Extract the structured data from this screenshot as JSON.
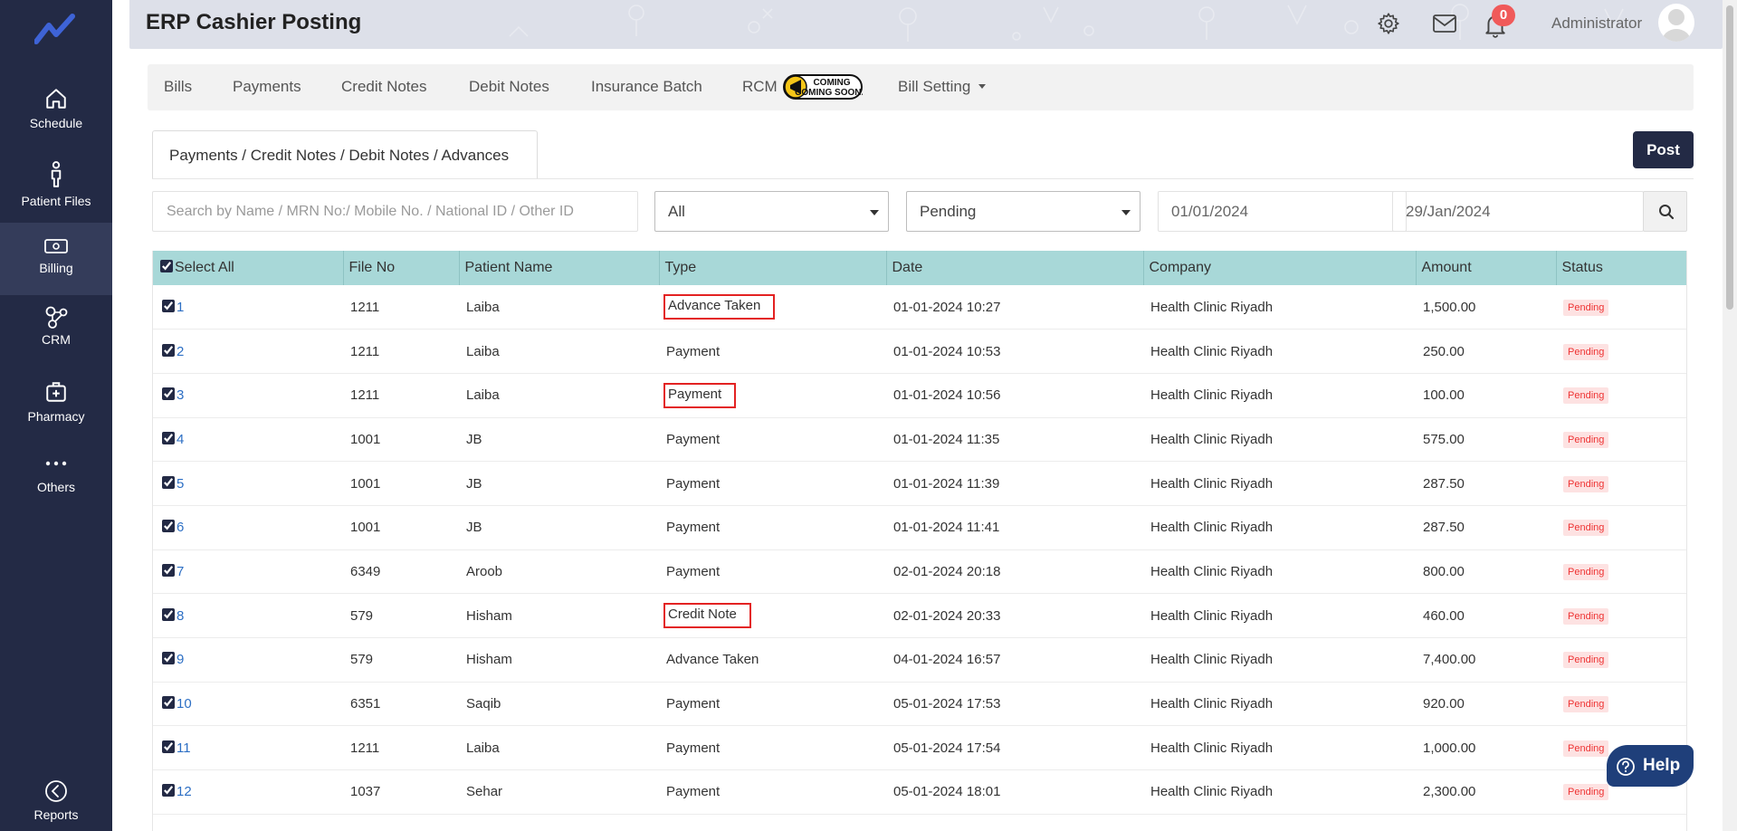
{
  "app": {
    "title": "ERP Cashier Posting"
  },
  "sidebar": {
    "items": [
      {
        "label": "Schedule",
        "icon": "home-icon"
      },
      {
        "label": "Patient Files",
        "icon": "person-icon"
      },
      {
        "label": "Billing",
        "icon": "money-icon",
        "active": true
      },
      {
        "label": "CRM",
        "icon": "network-icon"
      },
      {
        "label": "Pharmacy",
        "icon": "medical-bag-icon"
      },
      {
        "label": "Others",
        "icon": "more-dots-icon"
      },
      {
        "label": "Reports",
        "icon": "back-circle-icon"
      }
    ]
  },
  "header": {
    "notification_count": "0",
    "user_name": "Administrator"
  },
  "nav": {
    "items": [
      "Bills",
      "Payments",
      "Credit Notes",
      "Debit Notes",
      "Insurance Batch",
      "RCM",
      "Bill Setting"
    ],
    "coming_soon_badge": "COMING SOON..."
  },
  "section": {
    "tab_label": "Payments / Credit Notes / Debit Notes / Advances",
    "post_label": "Post"
  },
  "filters": {
    "search_placeholder": "Search by Name / MRN No:/ Mobile No. / National ID / Other ID",
    "type_value": "All",
    "status_value": "Pending",
    "from_date": "01/01/2024",
    "to_date": "29/Jan/2024"
  },
  "table": {
    "columns": [
      "Select All",
      "File No",
      "Patient Name",
      "Type",
      "Date",
      "Company",
      "Amount",
      "Status"
    ],
    "rows": [
      {
        "no": "1",
        "file": "1211",
        "name": "Laiba",
        "type": "Advance Taken",
        "date": "01-01-2024 10:27",
        "company": "Health Clinic Riyadh",
        "amount": "1,500.00",
        "status": "Pending",
        "highlight": true
      },
      {
        "no": "2",
        "file": "1211",
        "name": "Laiba",
        "type": "Payment",
        "date": "01-01-2024 10:53",
        "company": "Health Clinic Riyadh",
        "amount": "250.00",
        "status": "Pending"
      },
      {
        "no": "3",
        "file": "1211",
        "name": "Laiba",
        "type": "Payment",
        "date": "01-01-2024 10:56",
        "company": "Health Clinic Riyadh",
        "amount": "100.00",
        "status": "Pending",
        "highlight": true
      },
      {
        "no": "4",
        "file": "1001",
        "name": "JB",
        "type": "Payment",
        "date": "01-01-2024 11:35",
        "company": "Health Clinic Riyadh",
        "amount": "575.00",
        "status": "Pending"
      },
      {
        "no": "5",
        "file": "1001",
        "name": "JB",
        "type": "Payment",
        "date": "01-01-2024 11:39",
        "company": "Health Clinic Riyadh",
        "amount": "287.50",
        "status": "Pending"
      },
      {
        "no": "6",
        "file": "1001",
        "name": "JB",
        "type": "Payment",
        "date": "01-01-2024 11:41",
        "company": "Health Clinic Riyadh",
        "amount": "287.50",
        "status": "Pending"
      },
      {
        "no": "7",
        "file": "6349",
        "name": "Aroob",
        "type": "Payment",
        "date": "02-01-2024 20:18",
        "company": "Health Clinic Riyadh",
        "amount": "800.00",
        "status": "Pending"
      },
      {
        "no": "8",
        "file": "579",
        "name": "Hisham",
        "type": "Credit Note",
        "date": "02-01-2024 20:33",
        "company": "Health Clinic Riyadh",
        "amount": "460.00",
        "status": "Pending",
        "highlight": true
      },
      {
        "no": "9",
        "file": "579",
        "name": "Hisham",
        "type": "Advance Taken",
        "date": "04-01-2024 16:57",
        "company": "Health Clinic Riyadh",
        "amount": "7,400.00",
        "status": "Pending"
      },
      {
        "no": "10",
        "file": "6351",
        "name": "Saqib",
        "type": "Payment",
        "date": "05-01-2024 17:53",
        "company": "Health Clinic Riyadh",
        "amount": "920.00",
        "status": "Pending"
      },
      {
        "no": "11",
        "file": "1211",
        "name": "Laiba",
        "type": "Payment",
        "date": "05-01-2024 17:54",
        "company": "Health Clinic Riyadh",
        "amount": "1,000.00",
        "status": "Pending"
      },
      {
        "no": "12",
        "file": "1037",
        "name": "Sehar",
        "type": "Payment",
        "date": "05-01-2024 18:01",
        "company": "Health Clinic Riyadh",
        "amount": "2,300.00",
        "status": "Pending"
      }
    ]
  },
  "help": {
    "label": "Help"
  },
  "colors": {
    "sidebar_bg": "#232a45",
    "table_header_bg": "#a8d8d8",
    "link": "#2d6fc4",
    "pending_badge": "#e33333",
    "highlight_box": "#e32222"
  }
}
